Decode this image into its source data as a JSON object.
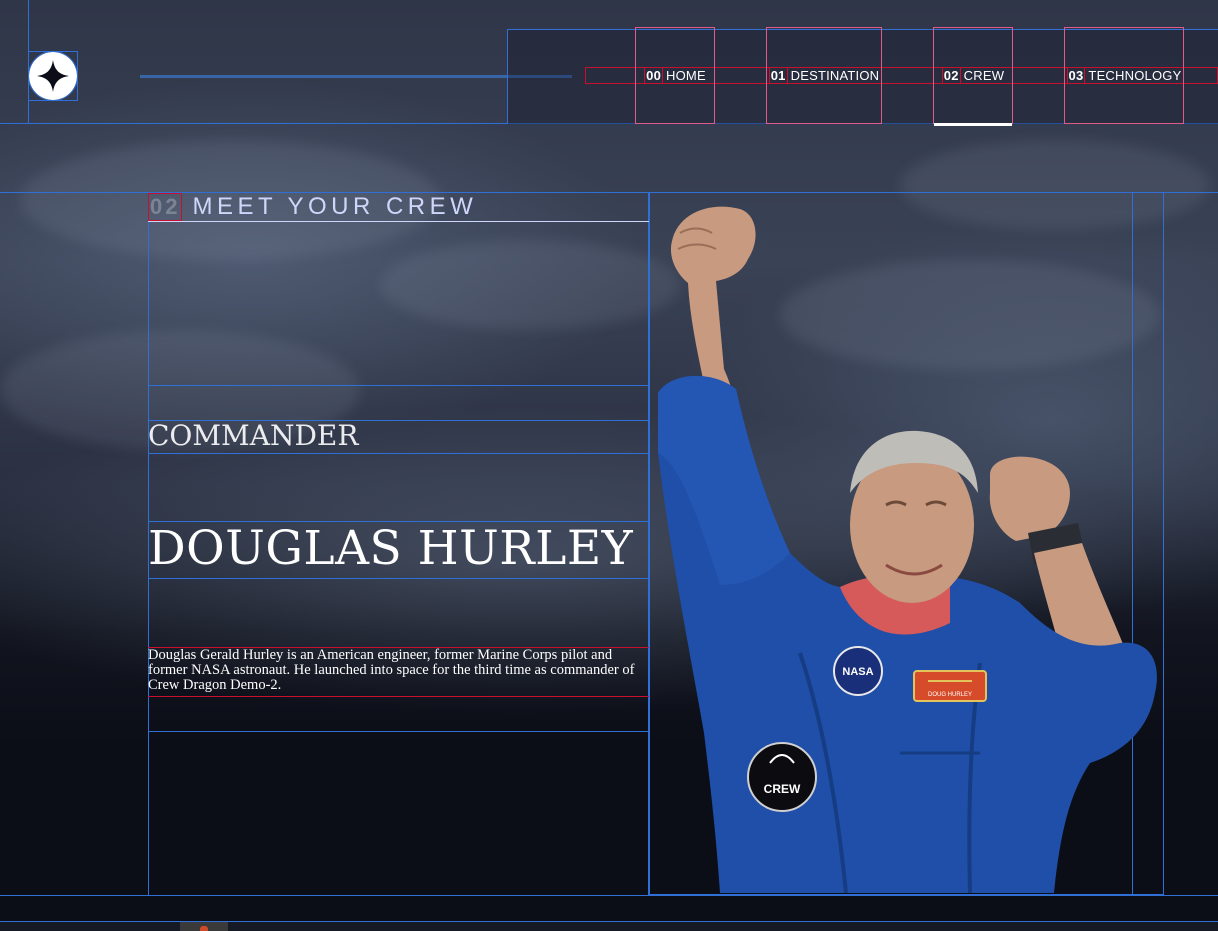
{
  "logo": {
    "icon": "star-logo-icon"
  },
  "nav": {
    "items": [
      {
        "num": "00",
        "label": "HOME"
      },
      {
        "num": "01",
        "label": "DESTINATION"
      },
      {
        "num": "02",
        "label": "CREW",
        "active": true
      },
      {
        "num": "03",
        "label": "TECHNOLOGY"
      }
    ]
  },
  "crew": {
    "subtitle_num": "02",
    "subtitle": "MEET YOUR CREW",
    "role": "COMMANDER",
    "name": "DOUGLAS HURLEY",
    "bio": "Douglas Gerald Hurley is an American engineer, former Marine Corps pilot and former NASA astronaut. He launched into space for the third time as commander of Crew Dragon Demo-2.",
    "image": {
      "subject": "astronaut-photo",
      "patch_nasa": "NASA",
      "patch_crew": "CREW",
      "nametag": "DOUG HURLEY"
    }
  },
  "colors": {
    "accent": "#2f6fd6",
    "highlight": "#c8102e",
    "nav_border": "#e05a8a",
    "bg": "#0b0d17",
    "suit": "#1f4fa8"
  }
}
